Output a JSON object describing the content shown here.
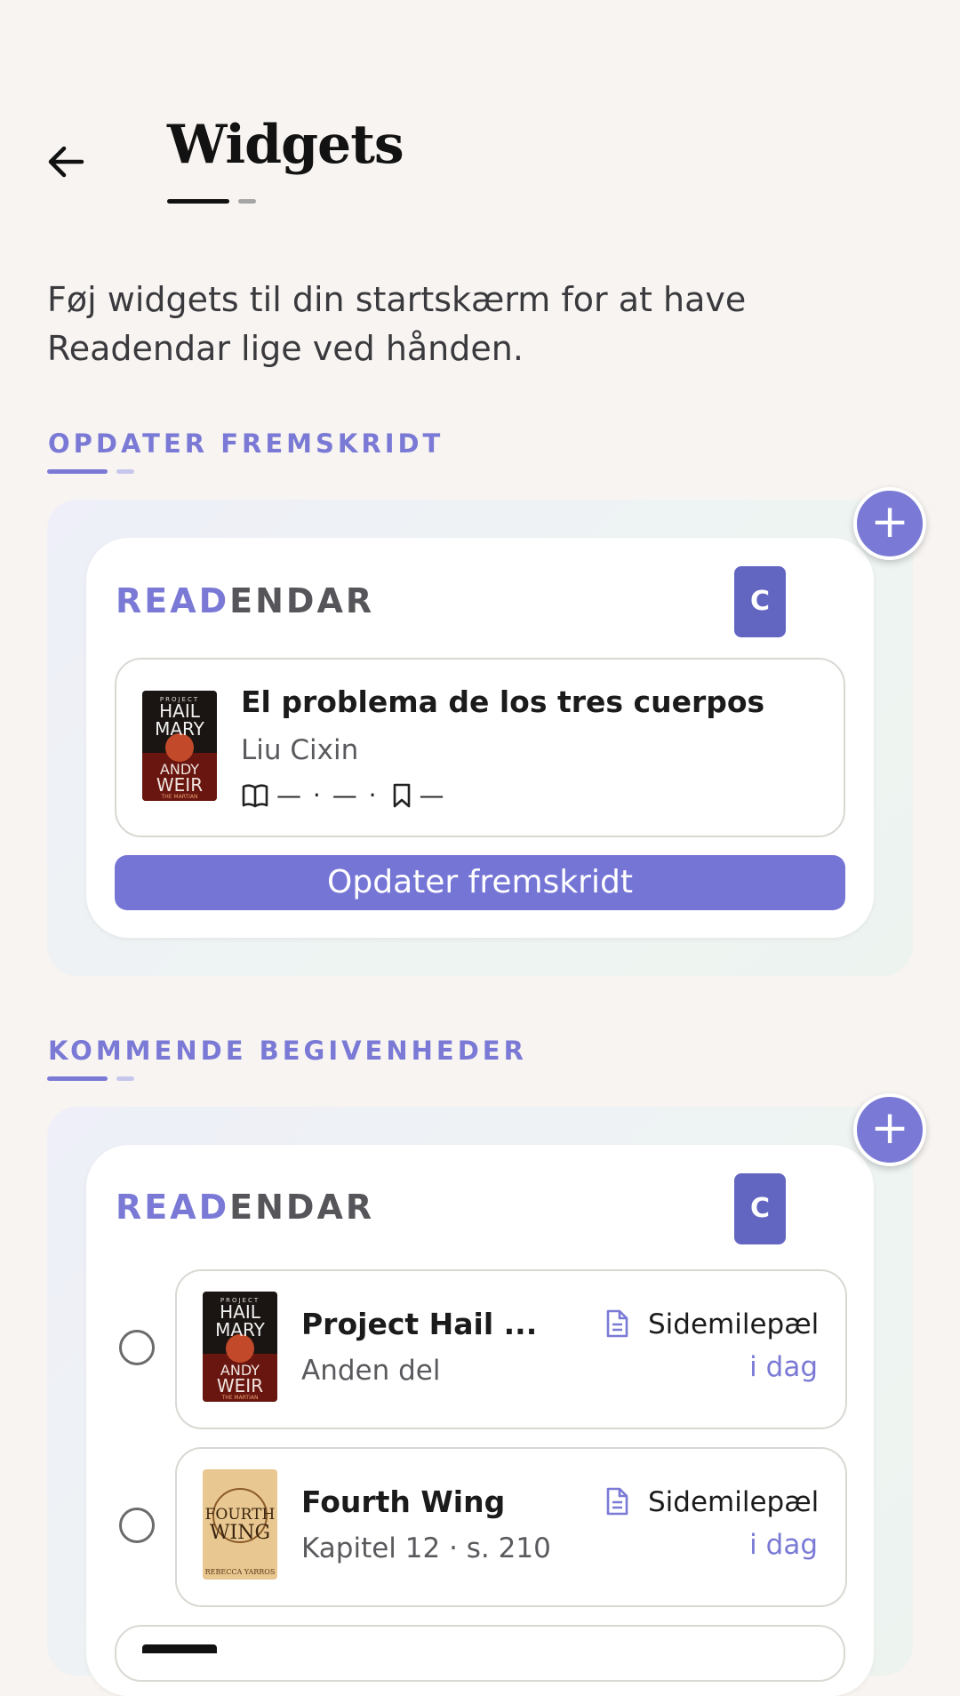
{
  "header": {
    "title": "Widgets"
  },
  "intro": {
    "line1": "Føj widgets til din startskærm for at have",
    "line2": "Readendar lige ved hånden."
  },
  "sections": [
    {
      "label": "OPDATER FREMSKRIDT",
      "add_label": "+",
      "brand_a": "READ",
      "brand_b": "ENDAR",
      "badge": "C",
      "book": {
        "title": "El problema de los tres cuerpos",
        "author": "Liu Cixin",
        "progress_text": "— · — ·",
        "bookmark_text": "—"
      },
      "button": "Opdater fremskridt"
    },
    {
      "label": "KOMMENDE BEGIVENHEDER",
      "add_label": "+",
      "brand_a": "READ",
      "brand_b": "ENDAR",
      "badge": "C",
      "events": [
        {
          "title": "Project Hail ...",
          "sub": "Anden del",
          "type": "Sidemilepæl",
          "when": "i dag"
        },
        {
          "title": "Fourth Wing",
          "sub": "Kapitel 12 · s. 210",
          "type": "Sidemilepæl",
          "when": "i dag"
        }
      ]
    }
  ],
  "covers": {
    "hail_mary": {
      "top": "PROJECT",
      "line1": "HAIL",
      "line2": "MARY",
      "line3": "ANDY",
      "line4": "WEIR",
      "foot": "THE MARTIAN"
    },
    "fourth_wing": {
      "line1": "FOURTH",
      "line2": "WING",
      "foot": "REBECCA YARROS"
    }
  },
  "colors": {
    "accent": "#7a7ad6",
    "badge": "#6366c1",
    "background": "#f8f4f1"
  }
}
